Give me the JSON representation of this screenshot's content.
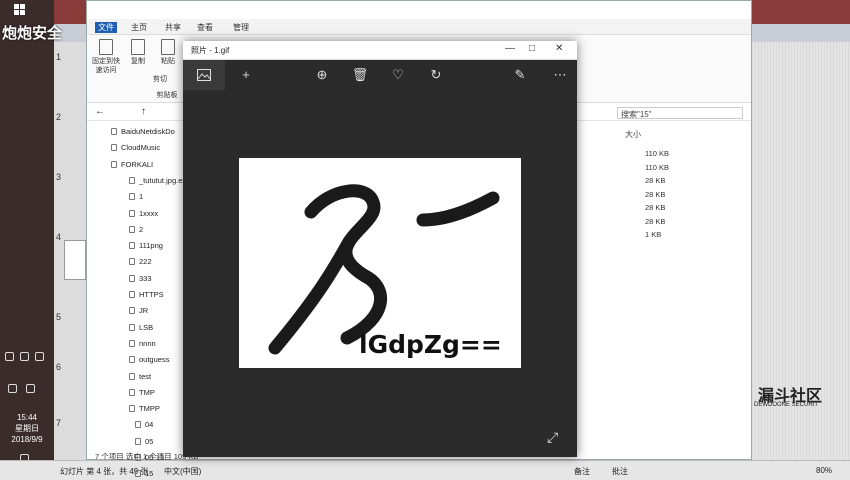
{
  "presentation": {
    "brand": "炮炮安全",
    "slide_numbers": [
      "1",
      "2",
      "3",
      "4",
      "5",
      "6",
      "7"
    ],
    "watermark": "漏斗社区",
    "watermark_sub": "DEWDOONE SECURIT",
    "clock_time": "15:44",
    "clock_day": "星期日",
    "clock_date": "2018/9/9",
    "status": {
      "slide_of": "幻灯片 第 4 张，共 49 张",
      "lang": "中文(中国)",
      "notes": "备注",
      "comments": "批注",
      "zoom": "80%"
    }
  },
  "explorer": {
    "tabs": [
      "文件",
      "主页",
      "共享",
      "查看",
      "管理"
    ],
    "ribbon": {
      "pin": "固定到快速访问",
      "copy": "复制",
      "paste": "粘贴",
      "cut": "剪切",
      "clipboard": "剪贴板"
    },
    "search_placeholder": "搜索\"15\"",
    "size_header": "大小",
    "nav_items": [
      "BaiduNetdiskDo",
      "CloudMusic",
      "FORKALI",
      "_tututut.jpg.ext",
      "1",
      "1xxxx",
      "2",
      "111png",
      "222",
      "333",
      "HTTPS",
      "JR",
      "LSB",
      "nnnn",
      "outguess",
      "test",
      "TMP",
      "TMPP",
      "04",
      "05",
      "06-13",
      "15"
    ],
    "sizes": [
      "110 KB",
      "110 KB",
      "28 KB",
      "28 KB",
      "28 KB",
      "28 KB",
      "1 KB"
    ],
    "status": "7 个项目    选中 1 个项目 109 KB"
  },
  "viewer": {
    "title": "照片 - 1.gif",
    "image_text": "lGdpZg==",
    "tools": {
      "add": "+",
      "zoom": "⊕",
      "delete": "🗑",
      "favorite": "♡",
      "rotate": "↻",
      "edit": "✎",
      "more": "⋯"
    }
  }
}
